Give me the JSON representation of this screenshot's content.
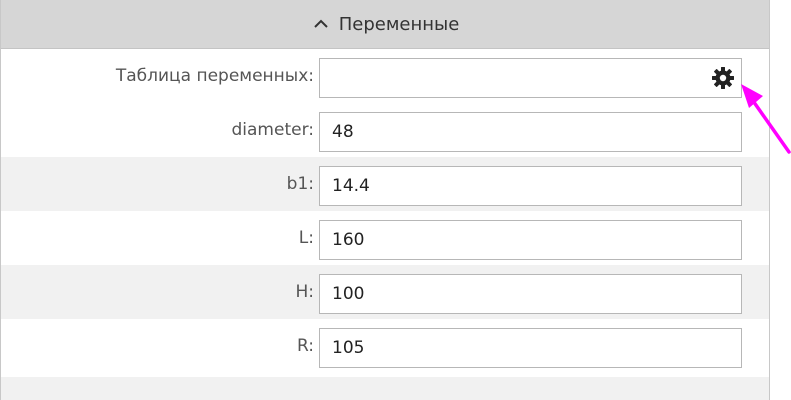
{
  "section": {
    "title": "Переменные",
    "expanded": true
  },
  "variable_table": {
    "label": "Таблица переменных:",
    "value": "",
    "settings_icon": "gear-icon"
  },
  "variables": [
    {
      "label": "diameter:",
      "value": "48"
    },
    {
      "label": "b1:",
      "value": "14.4"
    },
    {
      "label": "L:",
      "value": "160"
    },
    {
      "label": "H:",
      "value": "100"
    },
    {
      "label": "R:",
      "value": "105"
    }
  ],
  "colors": {
    "header_bg": "#d6d6d6",
    "row_alt_bg": "#f1f1f1",
    "annotation_arrow": "#ff00ff"
  }
}
